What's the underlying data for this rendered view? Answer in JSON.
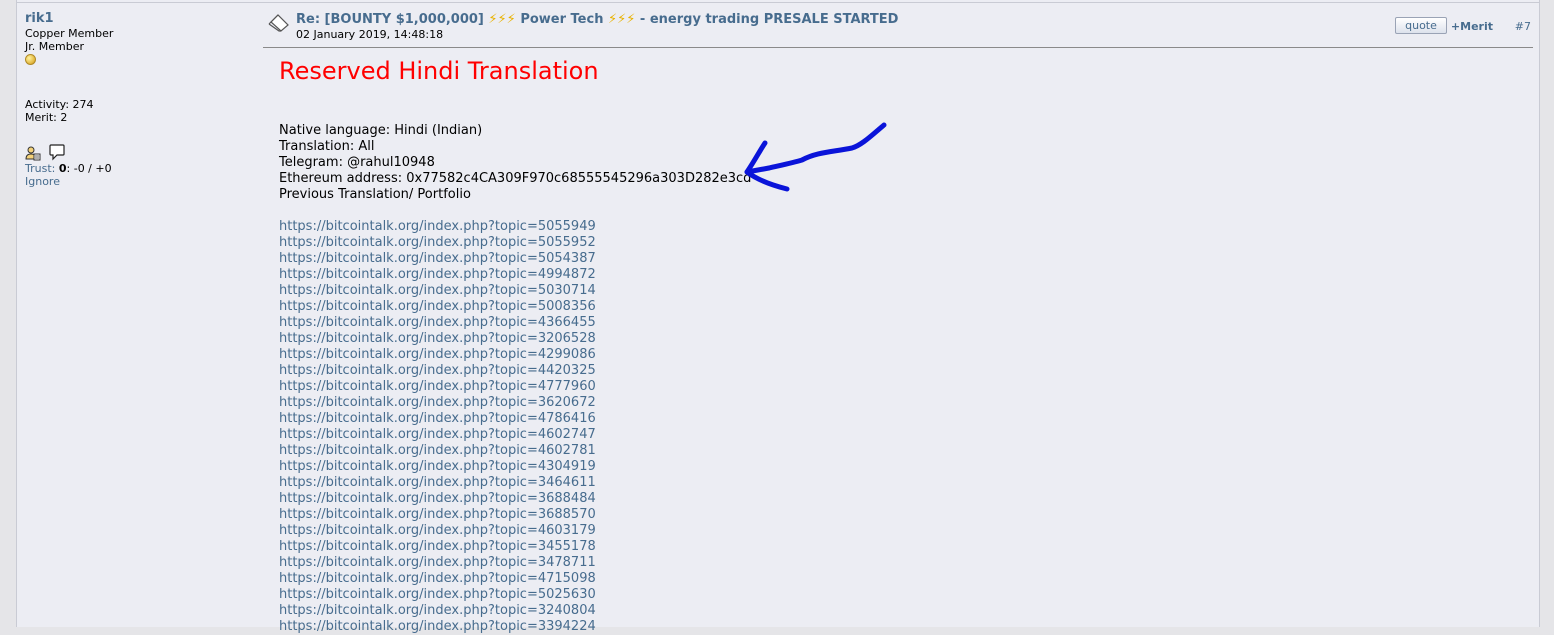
{
  "poster": {
    "name": "rik1",
    "rank_line1": "Copper Member",
    "rank_line2": "Jr. Member",
    "activity": "Activity: 274",
    "merit": "Merit: 2",
    "trust_label": "Trust:",
    "trust_score": "0",
    "trust_values": ": -0 / +0",
    "ignore": "Ignore"
  },
  "post": {
    "subject_prefix": "Re: [BOUNTY $1,000,000] ",
    "bolts": "⚡⚡⚡",
    "subject_middle": " Power Tech ",
    "subject_suffix": " - energy trading PRESALE STARTED",
    "date": "02 January 2019, 14:48:18",
    "quote_label": "quote",
    "merit_label": "+Merit",
    "post_number": "#7",
    "heading": "Reserved Hindi Translation",
    "lines": [
      "Native language: Hindi (Indian)",
      "Translation: All",
      "Telegram: @rahul10948",
      "Ethereum address: 0x77582c4CA309F970c68555545296a303D282e3cd",
      "Previous Translation/ Portfolio"
    ],
    "links": [
      "https://bitcointalk.org/index.php?topic=5055949",
      "https://bitcointalk.org/index.php?topic=5055952",
      "https://bitcointalk.org/index.php?topic=5054387",
      "https://bitcointalk.org/index.php?topic=4994872",
      "https://bitcointalk.org/index.php?topic=5030714",
      "https://bitcointalk.org/index.php?topic=5008356",
      "https://bitcointalk.org/index.php?topic=4366455",
      "https://bitcointalk.org/index.php?topic=3206528",
      "https://bitcointalk.org/index.php?topic=4299086",
      "https://bitcointalk.org/index.php?topic=4420325",
      "https://bitcointalk.org/index.php?topic=4777960",
      "https://bitcointalk.org/index.php?topic=3620672",
      "https://bitcointalk.org/index.php?topic=4786416",
      "https://bitcointalk.org/index.php?topic=4602747",
      "https://bitcointalk.org/index.php?topic=4602781",
      "https://bitcointalk.org/index.php?topic=4304919",
      "https://bitcointalk.org/index.php?topic=3464611",
      "https://bitcointalk.org/index.php?topic=3688484",
      "https://bitcointalk.org/index.php?topic=3688570",
      "https://bitcointalk.org/index.php?topic=4603179",
      "https://bitcointalk.org/index.php?topic=3455178",
      "https://bitcointalk.org/index.php?topic=3478711",
      "https://bitcointalk.org/index.php?topic=4715098",
      "https://bitcointalk.org/index.php?topic=5025630",
      "https://bitcointalk.org/index.php?topic=3240804",
      "https://bitcointalk.org/index.php?topic=3394224"
    ]
  },
  "icons": {
    "topic": "topic-document-icon",
    "coin": "coin-rank-icon",
    "profile": "user-profile-icon",
    "message": "speech-bubble-icon",
    "annotation": "hand-drawn-arrow-annotation"
  },
  "colors": {
    "link": "#476c8e",
    "heading": "#ff0000",
    "annotation": "#0a14d9"
  }
}
